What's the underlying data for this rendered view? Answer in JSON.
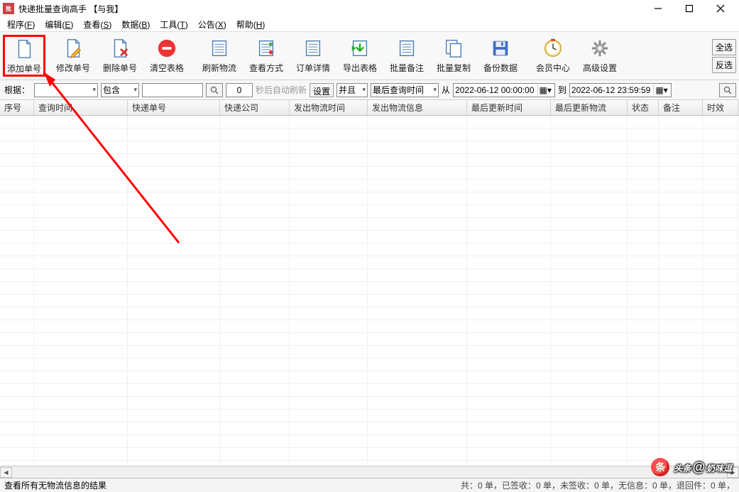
{
  "window": {
    "title": "快递批量查询高手 【与我】"
  },
  "menu": {
    "items": [
      {
        "label": "程序",
        "key": "F"
      },
      {
        "label": "编辑",
        "key": "E"
      },
      {
        "label": "查看",
        "key": "S"
      },
      {
        "label": "数据",
        "key": "B"
      },
      {
        "label": "工具",
        "key": "T"
      },
      {
        "label": "公告",
        "key": "X"
      },
      {
        "label": "帮助",
        "key": "H"
      }
    ]
  },
  "toolbar": {
    "buttons": [
      {
        "name": "add-order-button",
        "label": "添加单号",
        "icon": "doc-new",
        "highlight": true
      },
      {
        "name": "edit-order-button",
        "label": "修改单号",
        "icon": "doc-edit"
      },
      {
        "name": "delete-order-button",
        "label": "删除单号",
        "icon": "doc-delete"
      },
      {
        "name": "clear-table-button",
        "label": "清空表格",
        "icon": "clear"
      },
      {
        "name": "refresh-logistics-button",
        "label": "刷新物流",
        "icon": "list-refresh"
      },
      {
        "name": "view-mode-button",
        "label": "查看方式",
        "icon": "list-view"
      },
      {
        "name": "order-detail-button",
        "label": "订单详情",
        "icon": "list-detail"
      },
      {
        "name": "export-table-button",
        "label": "导出表格",
        "icon": "export"
      },
      {
        "name": "batch-remark-button",
        "label": "批量备注",
        "icon": "list-note"
      },
      {
        "name": "batch-copy-button",
        "label": "批量复制",
        "icon": "copy"
      },
      {
        "name": "backup-data-button",
        "label": "备份数据",
        "icon": "save"
      },
      {
        "name": "member-center-button",
        "label": "会员中心",
        "icon": "clock"
      },
      {
        "name": "advanced-settings-button",
        "label": "高级设置",
        "icon": "gear"
      }
    ],
    "select_all": "全选",
    "invert_select": "反选"
  },
  "filter": {
    "root_label": "根据：",
    "field_value": "",
    "match_value": "包含",
    "search_value": "",
    "count_value": "0",
    "auto_refresh": "秒后自动刷新",
    "settings_btn": "设置",
    "and_value": "并且",
    "time_field_value": "最后查询时间",
    "from_label": "从",
    "from_date": "2022-06-12 00:00:00",
    "to_label": "到",
    "to_date": "2022-06-12 23:59:59"
  },
  "grid": {
    "columns": [
      "序号",
      "查询时间",
      "快递单号",
      "快递公司",
      "发出物流时间",
      "发出物流信息",
      "最后更新时间",
      "最后更新物流",
      "状态",
      "备注",
      "时效"
    ]
  },
  "status": {
    "left": "查看所有无物流信息的结果",
    "right": "共：0 单，已签收：0 单，未签收：0 单，无信息：0 单，退回件：0 单，"
  },
  "watermark": {
    "prefix": "头条",
    "at": "@",
    "name": "奶味逗"
  }
}
